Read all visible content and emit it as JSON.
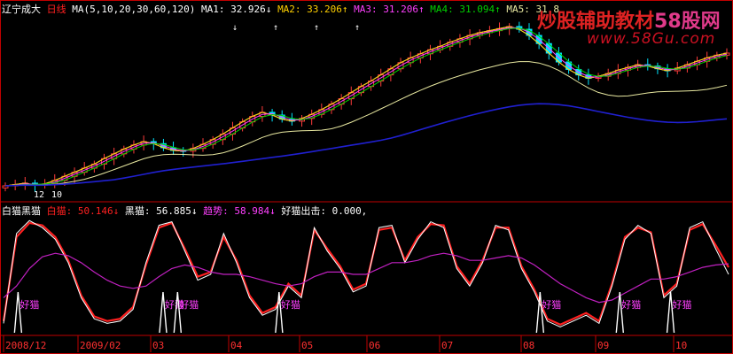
{
  "header_top": {
    "stock": "辽宁成大",
    "period": "日线",
    "ma_def": "MA(5,10,20,30,60,120)",
    "ma1": "MA1: 32.926↓",
    "ma2": "MA2: 33.206↑",
    "ma3": "MA3: 31.206↑",
    "ma4": "MA4: 31.094↑",
    "ma5": "MA5: 31.8"
  },
  "header_bottom": {
    "indicator": "白猫黑猫",
    "white_cat": "白猫: 50.146↓",
    "black_cat": "黑猫: 56.885↓",
    "trend": "趋势: 58.984↓",
    "signal": "好猫出击: 0.000,"
  },
  "watermark": {
    "cn_a": "炒股辅助教材",
    "cn_b": "58股网",
    "url": "www.58Gu.com"
  },
  "colors": {
    "up": "#ff3b3b",
    "down": "#00e5ff",
    "ma1": "#ffffff",
    "ma2": "#ffd000",
    "ma3": "#ff40ff",
    "ma4": "#00d000",
    "ma5": "#e8e8a0",
    "ma6": "#2020d0",
    "white_cat": "#ffffff",
    "black_cat": "#ff2020",
    "trend": "#c020c0",
    "signal": "#ffffff",
    "signal_label": "#ff40ff",
    "frame": "#c00000"
  },
  "chart_data": [
    {
      "type": "candlestick",
      "title": "辽宁成大 日线",
      "price_labels": [
        "12",
        "10"
      ],
      "ma_periods": [
        5,
        10,
        20,
        30,
        60,
        120
      ],
      "close_values": [
        11.8,
        12.0,
        12.2,
        11.9,
        12.1,
        12.6,
        13.2,
        13.8,
        14.4,
        15.0,
        15.8,
        16.5,
        17.2,
        17.8,
        18.3,
        18.0,
        17.4,
        17.0,
        16.9,
        17.3,
        17.9,
        18.6,
        19.4,
        20.3,
        21.2,
        22.0,
        22.6,
        22.2,
        21.6,
        21.3,
        21.7,
        22.3,
        23.0,
        23.8,
        24.6,
        25.5,
        26.4,
        27.2,
        28.1,
        29.0,
        29.9,
        30.6,
        31.2,
        31.8,
        32.3,
        32.9,
        33.4,
        33.9,
        34.3,
        34.6,
        34.9,
        35.2,
        34.8,
        33.9,
        32.7,
        31.3,
        30.0,
        28.9,
        28.1,
        27.6,
        27.9,
        28.3,
        28.8,
        29.2,
        29.6,
        29.4,
        29.0,
        28.7,
        29.1,
        29.6,
        30.1,
        30.6,
        31.0,
        31.3
      ],
      "ma_values": {
        "MA1": 32.926,
        "MA2": 33.206,
        "MA3": 31.206,
        "MA4": 31.094,
        "MA5": 31.8
      },
      "annotations": [
        "↓",
        "↑",
        "↑",
        "↑"
      ]
    },
    {
      "type": "line",
      "title": "白猫黑猫",
      "x_labels": [
        "2008/12",
        "2009/02",
        "03",
        "04",
        "05",
        "06",
        "07",
        "08",
        "09",
        "10"
      ],
      "series": [
        {
          "name": "白猫",
          "last": 50.146,
          "values": [
            8,
            85,
            96,
            90,
            80,
            60,
            30,
            12,
            8,
            10,
            20,
            60,
            92,
            95,
            70,
            45,
            50,
            85,
            60,
            30,
            15,
            20,
            40,
            30,
            90,
            70,
            55,
            35,
            40,
            90,
            92,
            60,
            80,
            95,
            90,
            55,
            40,
            60,
            92,
            88,
            55,
            35,
            10,
            5,
            10,
            15,
            8,
            40,
            80,
            92,
            85,
            30,
            40,
            90,
            95,
            72,
            50
          ]
        },
        {
          "name": "黑猫",
          "last": 56.885,
          "values": [
            10,
            82,
            94,
            92,
            82,
            62,
            32,
            14,
            10,
            12,
            22,
            58,
            90,
            94,
            72,
            48,
            52,
            82,
            62,
            32,
            17,
            22,
            42,
            32,
            88,
            72,
            57,
            37,
            42,
            88,
            90,
            62,
            82,
            93,
            92,
            57,
            42,
            62,
            90,
            90,
            57,
            37,
            12,
            7,
            12,
            17,
            10,
            42,
            82,
            90,
            86,
            32,
            42,
            88,
            93,
            75,
            56
          ]
        },
        {
          "name": "趋势",
          "last": 58.984,
          "values": [
            30,
            40,
            55,
            65,
            68,
            66,
            60,
            52,
            45,
            40,
            38,
            40,
            48,
            55,
            58,
            56,
            52,
            50,
            50,
            48,
            45,
            42,
            40,
            42,
            48,
            52,
            52,
            50,
            50,
            55,
            60,
            60,
            62,
            66,
            68,
            66,
            62,
            62,
            64,
            66,
            64,
            58,
            50,
            42,
            36,
            30,
            26,
            28,
            34,
            40,
            46,
            46,
            48,
            52,
            56,
            58,
            59
          ]
        },
        {
          "name": "好猫出击",
          "last": 0.0,
          "signal_positions": [
            2,
            22,
            24,
            38,
            74,
            85,
            92
          ],
          "label": "好猫"
        }
      ]
    }
  ]
}
